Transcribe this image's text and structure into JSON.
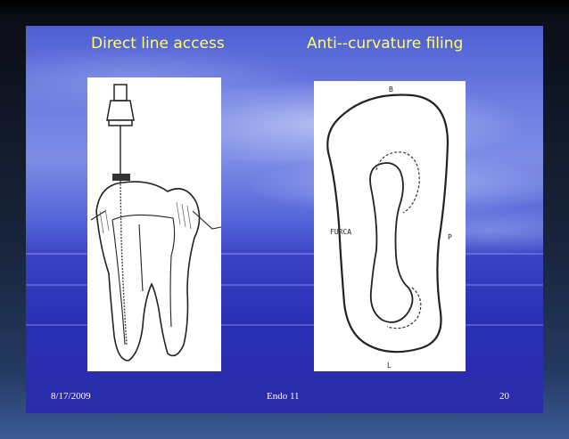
{
  "slide": {
    "title_left": "Direct line access",
    "title_right": "Anti--curvature filing"
  },
  "figure_right": {
    "label_top": "B",
    "label_left": "FURCA",
    "label_right": "P",
    "label_bottom": "L"
  },
  "footer": {
    "date": "8/17/2009",
    "center": "Endo 11",
    "page": "20"
  },
  "colors": {
    "title": "#ffff66",
    "footer_text": "#ffffff"
  }
}
